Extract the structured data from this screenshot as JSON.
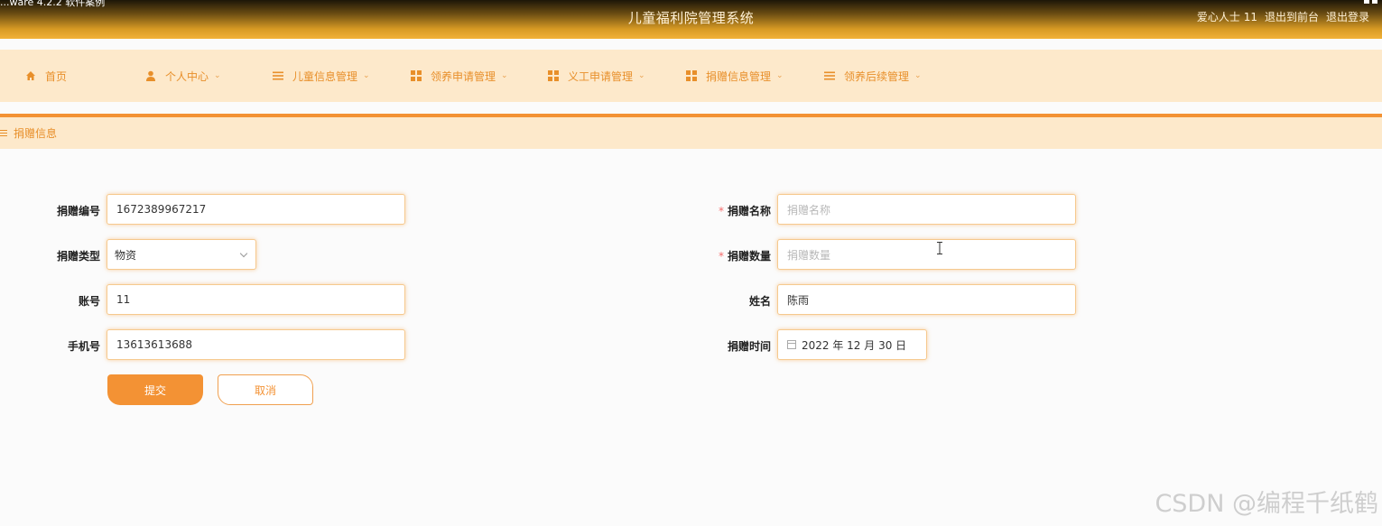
{
  "header": {
    "leak_text": "...ware 4.2.2 软件案例",
    "title": "儿童福利院管理系统",
    "user": "爱心人士 11",
    "to_front": "退出到前台",
    "logout": "退出登录"
  },
  "nav": {
    "items": [
      {
        "label": "首页",
        "icon": "home-icon"
      },
      {
        "label": "个人中心",
        "icon": "user-icon"
      },
      {
        "label": "儿童信息管理",
        "icon": "list-icon"
      },
      {
        "label": "领养申请管理",
        "icon": "grid-icon"
      },
      {
        "label": "义工申请管理",
        "icon": "grid-icon"
      },
      {
        "label": "捐赠信息管理",
        "icon": "grid-icon"
      },
      {
        "label": "领养后续管理",
        "icon": "list-icon"
      }
    ]
  },
  "breadcrumb": {
    "label": "捐赠信息"
  },
  "form": {
    "donation_no": {
      "label": "捐赠编号",
      "value": "1672389967217"
    },
    "donation_type": {
      "label": "捐赠类型",
      "value": "物资"
    },
    "account": {
      "label": "账号",
      "value": "11"
    },
    "phone": {
      "label": "手机号",
      "value": "13613613688"
    },
    "donation_name": {
      "label": "捐赠名称",
      "placeholder": "捐赠名称"
    },
    "donation_qty": {
      "label": "捐赠数量",
      "placeholder": "捐赠数量"
    },
    "name": {
      "label": "姓名",
      "value": "陈雨"
    },
    "donation_time": {
      "label": "捐赠时间",
      "value": "2022 年 12 月 30 日"
    },
    "submit": "提交",
    "cancel": "取消"
  },
  "watermark": "CSDN @编程千纸鹤",
  "colors": {
    "accent": "#f39234",
    "nav_bg": "#fde9cb",
    "label_required": "#f56c6c"
  }
}
